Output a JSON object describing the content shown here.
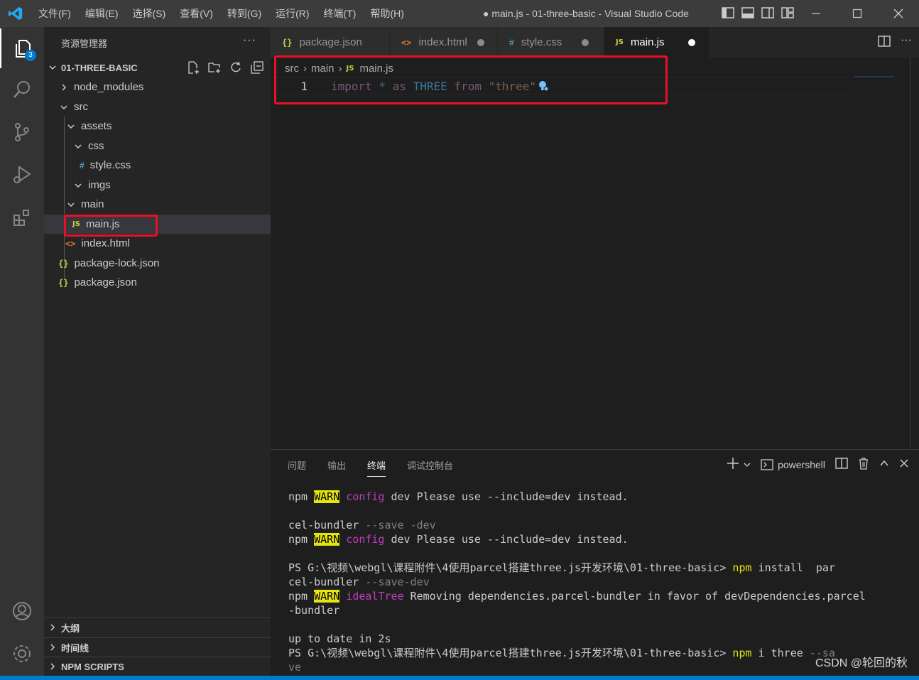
{
  "titlebar": {
    "menu": [
      "文件(F)",
      "编辑(E)",
      "选择(S)",
      "查看(V)",
      "转到(G)",
      "运行(R)",
      "终端(T)",
      "帮助(H)"
    ],
    "title": "● main.js - 01-three-basic - Visual Studio Code"
  },
  "activitybar": {
    "explorer_badge": "3"
  },
  "sidebar": {
    "header": "资源管理器",
    "more": "···",
    "root": "01-THREE-BASIC",
    "items": [
      {
        "label": "node_modules"
      },
      {
        "label": "src"
      },
      {
        "label": "assets"
      },
      {
        "label": "css"
      },
      {
        "label": "style.css",
        "icon": "#"
      },
      {
        "label": "imgs"
      },
      {
        "label": "main"
      },
      {
        "label": "main.js",
        "icon": "JS"
      },
      {
        "label": "index.html",
        "icon": "<>"
      },
      {
        "label": "package-lock.json",
        "icon": "{}"
      },
      {
        "label": "package.json",
        "icon": "{}"
      }
    ],
    "panels": [
      "大纲",
      "时间线",
      "NPM SCRIPTS"
    ]
  },
  "tabs": [
    {
      "label": "package.json",
      "icon": "{}"
    },
    {
      "label": "index.html",
      "icon": "<>"
    },
    {
      "label": "style.css",
      "icon": "#"
    },
    {
      "label": "main.js",
      "icon": "JS"
    }
  ],
  "editor": {
    "breadcrumb": [
      "src",
      "main",
      "main.js"
    ],
    "breadcrumb_icon": "JS",
    "line_number": "1",
    "code": {
      "import": "import",
      "star": "*",
      "as": "as",
      "id": "THREE",
      "from": "from",
      "str": "\"three\""
    }
  },
  "panel": {
    "tabs": [
      "问题",
      "输出",
      "终端",
      "调试控制台"
    ],
    "shell": "powershell",
    "terminal": {
      "l1_npm": "npm",
      "l1_warn": "WARN",
      "l1_cfg": "config",
      "l1_rest": " dev Please use --include=dev instead.",
      "l3a": "cel-bundler",
      "l3b": " --save -dev",
      "l4_npm": "npm",
      "l4_warn": "WARN",
      "l4_cfg": "config",
      "l4_rest": " dev Please use --include=dev instead.",
      "l6_ps": "PS G:\\视频\\webgl\\课程附件\\4使用parcel搭建three.js开发环境\\01-three-basic> ",
      "l6_npm": "npm",
      "l6_rest": " install  par",
      "l7a": "cel-bundler",
      "l7b": " --save-dev",
      "l8_npm": "npm",
      "l8_warn": "WARN",
      "l8_ideal": "idealTree",
      "l8_rest": " Removing dependencies.parcel-bundler in favor of devDependencies.parcel",
      "l9": "-bundler",
      "l11": "up to date in 2s",
      "l12_ps": "PS G:\\视频\\webgl\\课程附件\\4使用parcel搭建three.js开发环境\\01-three-basic> ",
      "l12_npm": "npm",
      "l12_rest": " i three ",
      "l12_dim": "--sa",
      "l13": "ve"
    }
  },
  "watermark": "CSDN @轮回的秋"
}
